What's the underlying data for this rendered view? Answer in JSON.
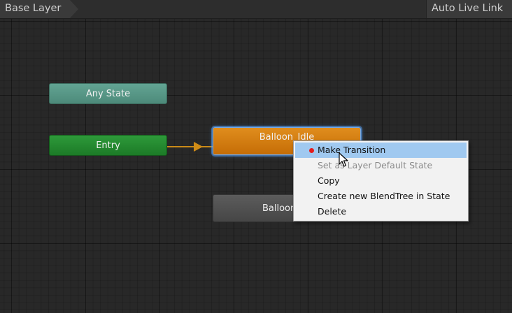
{
  "header": {
    "breadcrumb": "Base Layer",
    "auto_live_link": "Auto Live Link"
  },
  "nodes": {
    "any_state": "Any State",
    "entry": "Entry",
    "balloon_idle": "Balloon_Idle",
    "balloon_second": "Balloon_"
  },
  "context_menu": {
    "items": [
      {
        "label": "Make Transition",
        "highlighted": true,
        "disabled": false
      },
      {
        "label": "Set as Layer Default State",
        "highlighted": false,
        "disabled": true
      },
      {
        "label": "Copy",
        "highlighted": false,
        "disabled": false
      },
      {
        "label": "Create new BlendTree in State",
        "highlighted": false,
        "disabled": false
      },
      {
        "label": "Delete",
        "highlighted": false,
        "disabled": false
      }
    ]
  },
  "colors": {
    "canvas_bg": "#282828",
    "any_state": "#5a9b8a",
    "entry": "#248a30",
    "selected_state": "#d07a10",
    "default_state": "#555555",
    "selection_outline": "#76a8e3",
    "menu_highlight": "#a0c9f0",
    "transition_line": "#c98a18",
    "bullet": "#e41c1c"
  },
  "icons": {
    "arrow": "transition-arrow-icon",
    "cursor": "mouse-pointer-icon",
    "bullet": "red-dot-icon"
  }
}
